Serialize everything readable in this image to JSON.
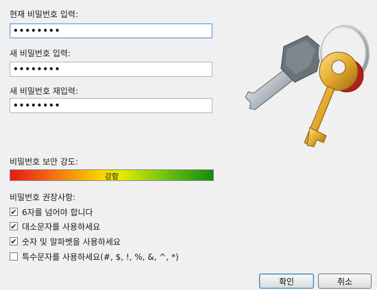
{
  "current_password": {
    "label": "현재 비밀번호 입력:",
    "value": "password"
  },
  "new_password": {
    "label": "새 비밀번호 입력:",
    "value": "password"
  },
  "confirm_password": {
    "label": "새 비밀번호 재입력:",
    "value": "password"
  },
  "strength": {
    "label": "비밀번호 보안 강도:",
    "level_text": "강함"
  },
  "recommendations": {
    "label": "비밀번호 권장사항:",
    "items": [
      {
        "text": "6자를 넘어야 합니다",
        "checked": true
      },
      {
        "text": "대소문자를 사용하세요",
        "checked": true
      },
      {
        "text": "숫자 및 알파벳을 사용하세요",
        "checked": true
      },
      {
        "text": "특수문자를 사용하세요(#, $, !, %, &, ^, *)",
        "checked": false
      }
    ]
  },
  "buttons": {
    "ok": "확인",
    "cancel": "취소"
  },
  "icon": "keys-icon"
}
